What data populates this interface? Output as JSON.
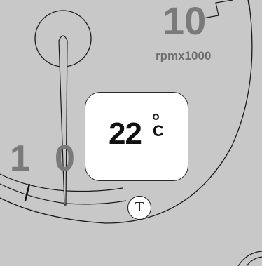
{
  "gauge": {
    "scale_top_label": "10",
    "unit_label": "rpmx1000",
    "scale_left_label_a": "1",
    "scale_left_label_b": "0"
  },
  "temperature": {
    "value": "22",
    "unit": "C"
  },
  "badge": {
    "label": "T"
  }
}
